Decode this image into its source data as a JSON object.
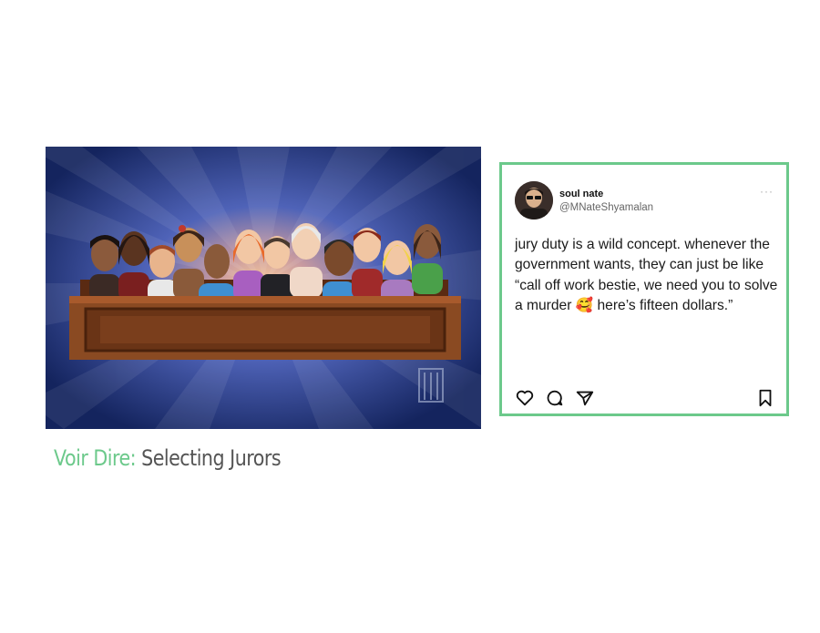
{
  "slide": {
    "caption": {
      "accent": "Voir Dire:",
      "rest": " Selecting Jurors"
    }
  },
  "tweet": {
    "display_name": "soul nate",
    "handle": "@MNateShyamalan",
    "more": "···",
    "text": "jury duty is a wild concept. whenever the government wants, they can just be like “call off work bestie, we need you to solve a murder 🥰 here’s fifteen dollars.”",
    "icons": [
      "heart-icon",
      "comment-icon",
      "share-icon",
      "bookmark-icon"
    ]
  },
  "colors": {
    "accent": "#6cc98b"
  }
}
